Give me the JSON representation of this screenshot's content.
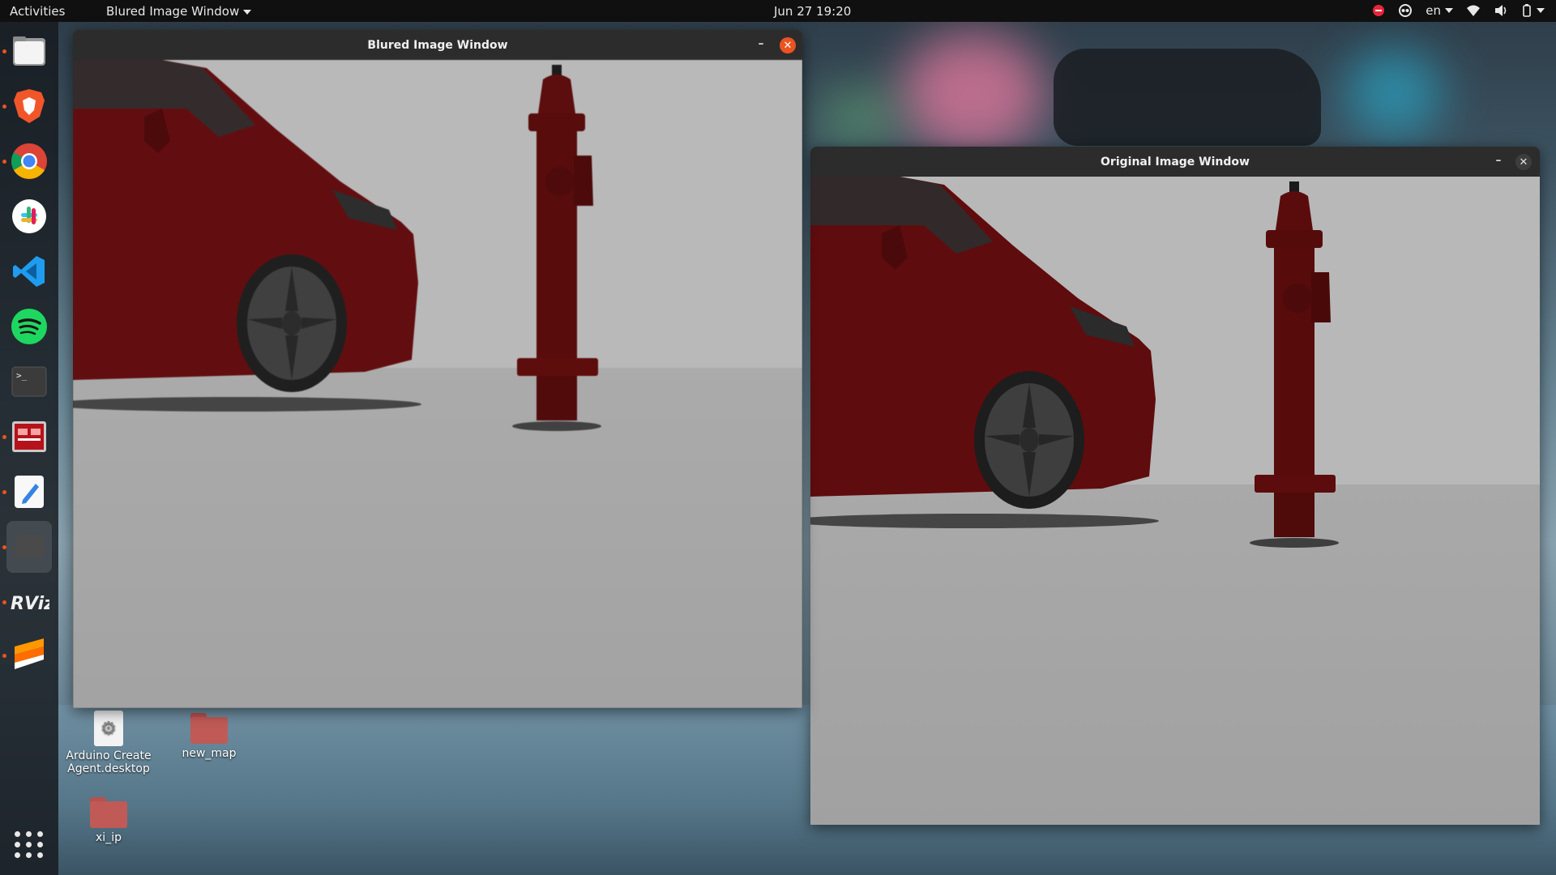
{
  "topbar": {
    "activities": "Activities",
    "app_menu": "Blured Image Window",
    "clock": "Jun 27  19:20",
    "lang": "en",
    "icons": [
      "do-not-disturb-icon",
      "privacy-icon",
      "wifi-icon",
      "volume-icon",
      "power-icon"
    ]
  },
  "dock": {
    "items": [
      {
        "name": "files-icon",
        "running": true
      },
      {
        "name": "brave-browser-icon",
        "running": true
      },
      {
        "name": "chrome-icon",
        "running": true
      },
      {
        "name": "slack-icon",
        "running": false
      },
      {
        "name": "vscode-icon",
        "running": false
      },
      {
        "name": "spotify-icon",
        "running": false
      },
      {
        "name": "terminal-icon",
        "running": false
      },
      {
        "name": "gazebo-icon",
        "running": true
      },
      {
        "name": "text-editor-icon",
        "running": true
      },
      {
        "name": "image-viewer-icon",
        "running": true,
        "active": true
      },
      {
        "name": "rviz-icon",
        "running": true
      },
      {
        "name": "sublime-text-icon",
        "running": true
      }
    ],
    "rviz_label": "RViz",
    "show_apps": "show-applications-icon"
  },
  "windows": {
    "blurred": {
      "title": "Blured Image Window",
      "minimize": "–",
      "close": "✕",
      "focused": true
    },
    "original": {
      "title": "Original Image Window",
      "minimize": "–",
      "close": "✕",
      "focused": false
    }
  },
  "desktop_icons": [
    {
      "label": "Arduino Create Agent.desktop",
      "type": "desktop-file"
    },
    {
      "label": "new_map",
      "type": "folder"
    },
    {
      "label": "xi_ip",
      "type": "folder"
    }
  ],
  "colors": {
    "accent": "#e95420",
    "car": "#6e0f0f",
    "hydrant": "#5a0c0c"
  }
}
